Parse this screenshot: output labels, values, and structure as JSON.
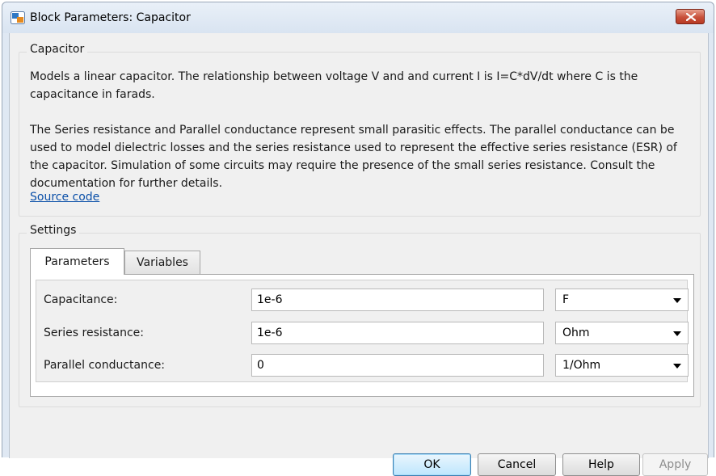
{
  "window": {
    "title": "Block Parameters: Capacitor"
  },
  "description_group": {
    "title": "Capacitor",
    "paragraph1_lines": [
      "Models a linear capacitor. The relationship between voltage V and and current I is I=C*dV/dt where C is the",
      "capacitance in farads."
    ],
    "paragraph2_lines": [
      "The Series resistance and Parallel conductance represent small parasitic effects. The parallel conductance can be",
      "used to model dielectric losses and the series resistance used to represent the effective series resistance (ESR) of",
      "the capacitor. Simulation of some circuits may require the presence of the small series resistance. Consult the",
      "documentation for further details."
    ],
    "source_link": "Source code"
  },
  "settings_group": {
    "title": "Settings",
    "tabs": [
      {
        "label": "Parameters",
        "active": true
      },
      {
        "label": "Variables",
        "active": false
      }
    ],
    "parameters": [
      {
        "label": "Capacitance:",
        "value": "1e-6",
        "unit": "F"
      },
      {
        "label": "Series resistance:",
        "value": "1e-6",
        "unit": "Ohm"
      },
      {
        "label": "Parallel conductance:",
        "value": "0",
        "unit": "1/Ohm"
      }
    ]
  },
  "buttons": {
    "ok": "OK",
    "cancel": "Cancel",
    "help": "Help",
    "apply": "Apply"
  },
  "icons": {
    "app": "simulink-block-icon",
    "close": "close-icon"
  }
}
